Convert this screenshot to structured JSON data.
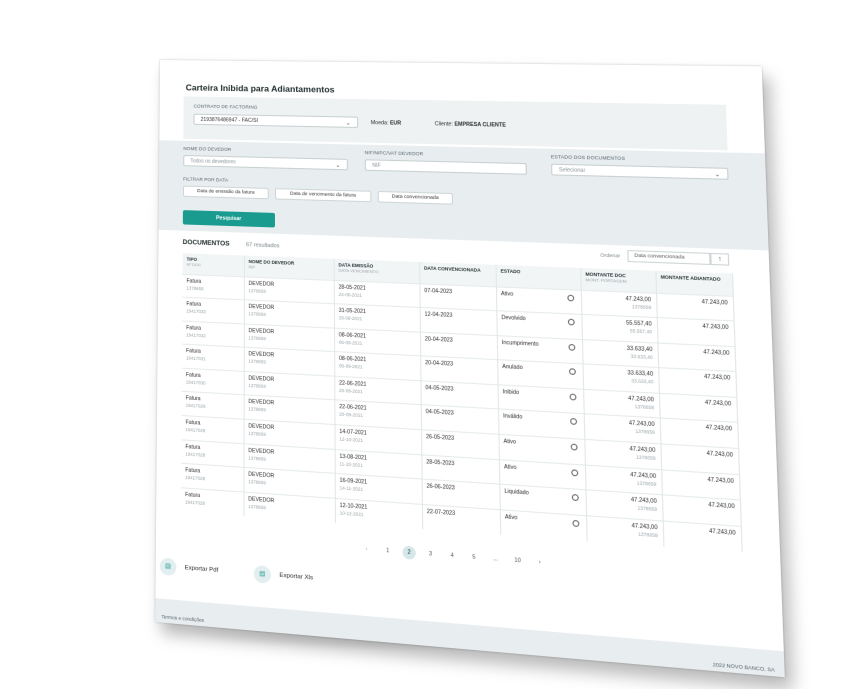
{
  "page": {
    "title": "Carteira Inibida para Adiantamentos"
  },
  "contract": {
    "label": "CONTRATO DE FACTORING",
    "selected": "2193876486947 - FAC/SI",
    "currency_label": "Moeda:",
    "currency": "EUR",
    "client_label": "Cliente:",
    "client": "EMPRESA CLIENTE"
  },
  "filters": {
    "debtor_label": "NOME DO DEVEDOR",
    "debtor_value": "Todos os devedores",
    "nif_label": "NIF/NIPC/VAT DEVEDOR",
    "nif_placeholder": "NIF",
    "state_label": "ESTADO DOS DOCUMENTOS",
    "state_value": "Selecionar",
    "date_label": "FILTRAR POR DATA",
    "date_pills": [
      "Data de emissão da fatura",
      "Data de vencimento da fatura",
      "Data convencionada"
    ],
    "search_button": "Pesquisar"
  },
  "documents": {
    "title": "DOCUMENTOS",
    "count": "67 resultados",
    "sort_label": "Ordenar",
    "sort_value": "Data convencionada",
    "sort_icon": "arrow-up-icon",
    "columns": [
      {
        "title": "TIPO",
        "sub": "Nº DOC"
      },
      {
        "title": "NOME DO DEVEDOR",
        "sub": "NIF"
      },
      {
        "title": "DATA EMISSÃO",
        "sub": "DATA VENCIMENTO"
      },
      {
        "title": "DATA CONVENCIONADA",
        "sub": ""
      },
      {
        "title": "ESTADO",
        "sub": ""
      },
      {
        "title": "MONTANTE DOC",
        "sub": "MONT. PORTAGEM"
      },
      {
        "title": "MONTANTE ADIANTADO",
        "sub": ""
      }
    ],
    "rows": [
      {
        "tipo": "Fatura",
        "doc": "1378659",
        "nome": "DEVEDOR",
        "nif": "1378659",
        "emissao": "28-05-2021",
        "vencimento": "24-08-2021",
        "convencionada": "07-04-2023",
        "estado": "Ativo",
        "montante": "47.243,00",
        "portagem": "1378659",
        "adiantado": "47.243,00"
      },
      {
        "tipo": "Fatura",
        "doc": "19417033",
        "nome": "DEVEDOR",
        "nif": "1378659",
        "emissao": "31-05-2021",
        "vencimento": "29-08-2021",
        "convencionada": "12-04-2023",
        "estado": "Devolvido",
        "montante": "55.557,40",
        "portagem": "55.557,40",
        "adiantado": "47.243,00"
      },
      {
        "tipo": "Fatura",
        "doc": "19417032",
        "nome": "DEVEDOR",
        "nif": "1378659",
        "emissao": "08-06-2021",
        "vencimento": "06-09-2021",
        "convencionada": "20-04-2023",
        "estado": "Incumprimento",
        "montante": "33.633,40",
        "portagem": "33.633,40",
        "adiantado": "47.243,00"
      },
      {
        "tipo": "Fatura",
        "doc": "19417031",
        "nome": "DEVEDOR",
        "nif": "1378659",
        "emissao": "08-06-2021",
        "vencimento": "06-09-2021",
        "convencionada": "20-04-2023",
        "estado": "Anulado",
        "montante": "33.633,40",
        "portagem": "33.633,40",
        "adiantado": "47.243,00"
      },
      {
        "tipo": "Fatura",
        "doc": "19417030",
        "nome": "DEVEDOR",
        "nif": "1378659",
        "emissao": "22-06-2021",
        "vencimento": "20-09-2021",
        "convencionada": "04-05-2023",
        "estado": "Inibido",
        "montante": "47.243,00",
        "portagem": "1378659",
        "adiantado": "47.243,00"
      },
      {
        "tipo": "Fatura",
        "doc": "19417029",
        "nome": "DEVEDOR",
        "nif": "1378659",
        "emissao": "22-06-2021",
        "vencimento": "20-09-2021",
        "convencionada": "04-05-2023",
        "estado": "Inválido",
        "montante": "47.243,00",
        "portagem": "1378659",
        "adiantado": "47.243,00"
      },
      {
        "tipo": "Fatura",
        "doc": "19417028",
        "nome": "DEVEDOR",
        "nif": "1378659",
        "emissao": "14-07-2021",
        "vencimento": "12-10-2021",
        "convencionada": "26-05-2023",
        "estado": "Ativo",
        "montante": "47.243,00",
        "portagem": "1378659",
        "adiantado": "47.243,00"
      },
      {
        "tipo": "Fatura",
        "doc": "19417028",
        "nome": "DEVEDOR",
        "nif": "1378659",
        "emissao": "13-08-2021",
        "vencimento": "11-10-2021",
        "convencionada": "28-05-2023",
        "estado": "Ativo",
        "montante": "47.243,00",
        "portagem": "1378659",
        "adiantado": "47.243,00"
      },
      {
        "tipo": "Fatura",
        "doc": "19417028",
        "nome": "DEVEDOR",
        "nif": "1378659",
        "emissao": "16-09-2021",
        "vencimento": "14-11-2021",
        "convencionada": "26-06-2023",
        "estado": "Liquidado",
        "montante": "47.243,00",
        "portagem": "1378659",
        "adiantado": "47.243,00"
      },
      {
        "tipo": "Fatura",
        "doc": "19417028",
        "nome": "DEVEDOR",
        "nif": "1378659",
        "emissao": "12-10-2021",
        "vencimento": "10-12-2021",
        "convencionada": "22-07-2023",
        "estado": "Ativo",
        "montante": "47.243,00",
        "portagem": "1378659",
        "adiantado": "47.243,00"
      }
    ]
  },
  "pagination": {
    "prev": "‹",
    "pages": [
      "1",
      "2",
      "3",
      "4",
      "5",
      "...",
      "10"
    ],
    "active_page": "2",
    "next": "›"
  },
  "exports": {
    "pdf": "Exportar Pdf",
    "xls": "Exportar Xls"
  },
  "footer": {
    "left": "Termos e condições",
    "right": "2022 NOVO BANCO, SA"
  },
  "colors": {
    "accent": "#1a9b90",
    "band": "#e8eef0"
  }
}
